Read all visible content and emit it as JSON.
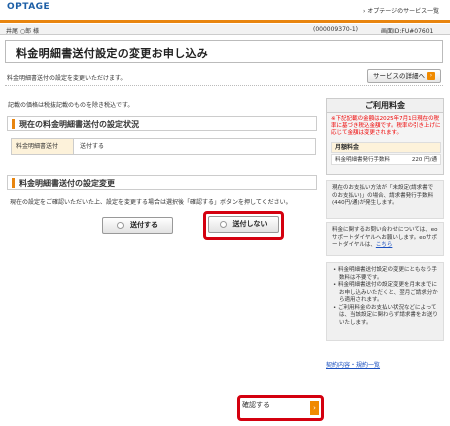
{
  "header": {
    "logo": "OPTAGE",
    "logo_sub": "",
    "services_link": "› オプテージのサービス一覧"
  },
  "infobar": {
    "user": "井尾 ○郎 様",
    "customer_id": "(000009370-1)",
    "screen_id": "画面ID:FU#07601"
  },
  "page": {
    "title": "料金明細書送付設定の変更お申し込み",
    "subtitle": "料金明細書送付の設定を変更いただけます。",
    "service_detail_button": "サービスの詳細へ",
    "tax_note": "記載の価格は税抜記載のものを除き税込です。"
  },
  "current_section": {
    "heading": "現在の料金明細書送付の設定状況",
    "label": "料金明細書送付",
    "value": "送付する"
  },
  "change_section": {
    "heading": "料金明細書送付の設定変更",
    "description": "現在の設定をご確認いただいた上、設定を変更する場合は選択後「確認する」ボタンを押してください。",
    "option_send": "送付する",
    "option_no_send": "送付しない"
  },
  "pricing": {
    "heading": "ご利用料金",
    "notice": "※下記記載の金額は2025年7月1日現在の税率に基づき税込金額です。税率の引き上げに応じて金額は変更されます。",
    "monthly_label": "月額料金",
    "fee_label": "料金明細書発行手数料",
    "fee_value": "220 円/通"
  },
  "info1": "現在のお支払い方法が「未設定(請求書でのお支払い)」の場合、請求書発行手数料(440円/通)が発生します。",
  "info2_pre": "料金に関するお問い合わせについては、eoサポートダイヤルへお願いします。eoサポートダイヤルは、",
  "info2_link": "こちら",
  "info3": [
    "料金明細書送付設定の変更にともなう手数料は不要です。",
    "料金明細書送付の設定変更を月末までにお申し込みいただくと、翌月ご請求分から適用されます。",
    "ご利用料金のお支払い状況などによっては、当該設定に関わらず請求書をお送りいたします。"
  ],
  "side_link": "契約内容・規約一覧",
  "confirm_button": "確認する",
  "colors": {
    "accent": "#e8850f",
    "highlight_frame": "#d4000f",
    "link": "#1a50c0",
    "brand": "#1d5fa6"
  }
}
